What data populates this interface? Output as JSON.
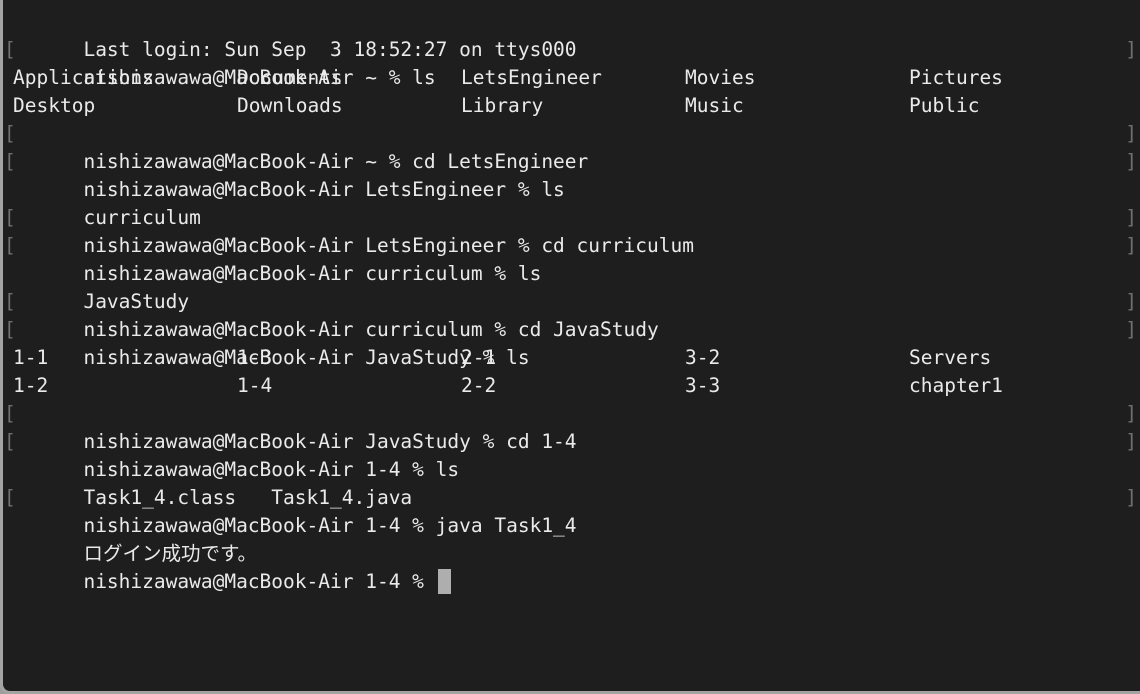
{
  "terminal": {
    "last_login": "Last login: Sun Sep  3 18:52:27 on ttys000",
    "cmd1": "nishizawawa@MacBook-Air ~ % ls",
    "ls1": {
      "row1": [
        "Applications",
        "Documents",
        "LetsEngineer",
        "Movies",
        "Pictures"
      ],
      "row2": [
        "Desktop",
        "Downloads",
        "Library",
        "Music",
        "Public"
      ]
    },
    "cmd2": "nishizawawa@MacBook-Air ~ % cd LetsEngineer",
    "cmd3": "nishizawawa@MacBook-Air LetsEngineer % ls",
    "ls2": "curriculum",
    "cmd4": "nishizawawa@MacBook-Air LetsEngineer % cd curriculum",
    "cmd5": "nishizawawa@MacBook-Air curriculum % ls",
    "ls3": "JavaStudy",
    "cmd6": "nishizawawa@MacBook-Air curriculum % cd JavaStudy",
    "cmd7": "nishizawawa@MacBook-Air JavaStudy % ls",
    "ls4": {
      "row1": [
        "1-1",
        "1-3",
        "2-1",
        "3-2",
        "Servers"
      ],
      "row2": [
        "1-2",
        "1-4",
        "2-2",
        "3-3",
        "chapter1"
      ]
    },
    "cmd8": "nishizawawa@MacBook-Air JavaStudy % cd 1-4",
    "cmd9": "nishizawawa@MacBook-Air 1-4 % ls",
    "ls5": "Task1_4.class   Task1_4.java",
    "cmd10": "nishizawawa@MacBook-Air 1-4 % java Task1_4",
    "output": "ログイン成功です。",
    "current_prompt": "nishizawawa@MacBook-Air 1-4 % "
  }
}
